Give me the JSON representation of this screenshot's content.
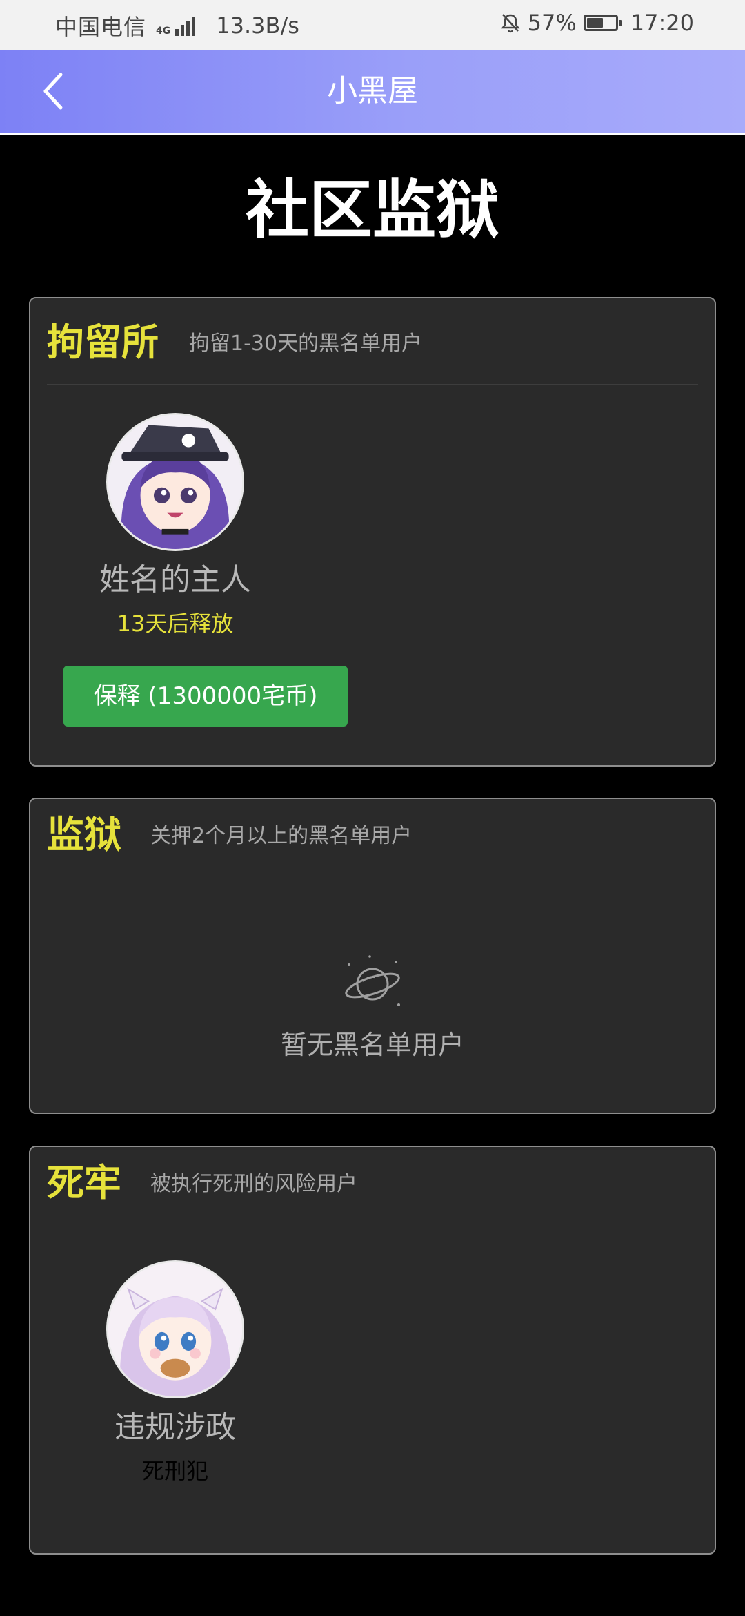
{
  "status_bar": {
    "carrier": "中国电信",
    "network": "4G",
    "speed": "13.3B/s",
    "battery": "57%",
    "battery_level": 0.57,
    "time": "17:20"
  },
  "header": {
    "title": "小黑屋",
    "back_icon": "chevron-left-icon"
  },
  "page_title": "社区监狱",
  "sections": [
    {
      "title": "拘留所",
      "description": "拘留1-30天的黑名单用户",
      "users": [
        {
          "name": "姓名的主人",
          "status": "13天后释放",
          "status_color": "#e6e23b",
          "action_label": "保释 (1300000宅币)"
        }
      ]
    },
    {
      "title": "监狱",
      "description": "关押2个月以上的黑名单用户",
      "empty_text": "暂无黑名单用户",
      "empty_icon": "planet-icon"
    },
    {
      "title": "死牢",
      "description": "被执行死刑的风险用户",
      "users": [
        {
          "name": "违规涉政",
          "status": "死刑犯",
          "status_color": "#000000"
        }
      ]
    }
  ],
  "colors": {
    "accent_yellow": "#e6e23b",
    "bail_green": "#37a74e",
    "header_gradient_start": "#7d81f5",
    "header_gradient_end": "#a8abfa"
  }
}
